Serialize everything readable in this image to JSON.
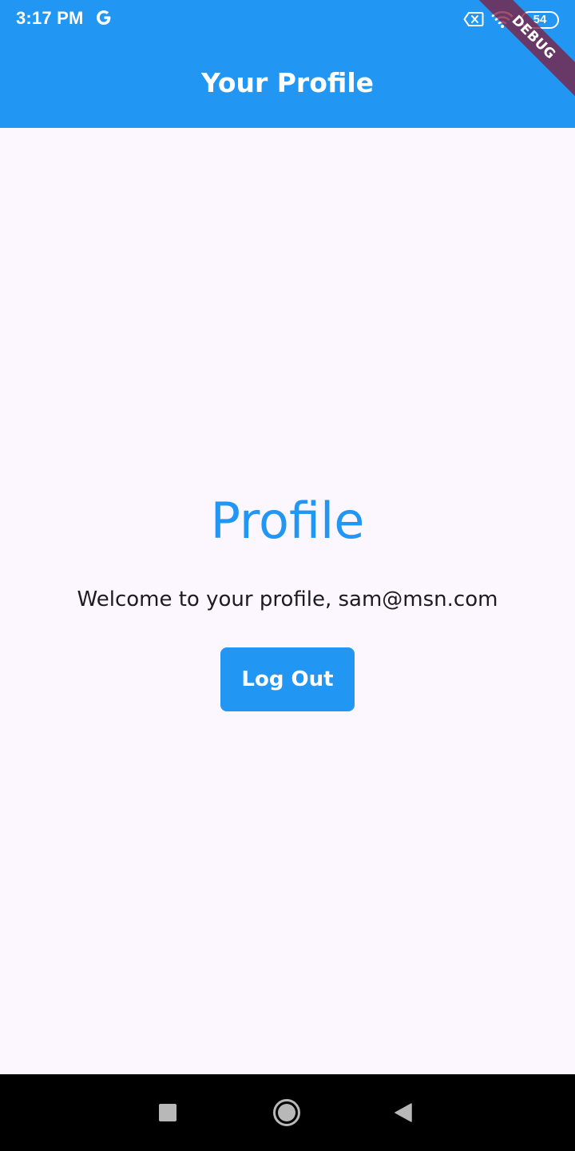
{
  "status_bar": {
    "time": "3:17 PM",
    "battery_level": "54",
    "icons": [
      "google-g-icon",
      "no-sim-icon",
      "wifi-icon",
      "battery-icon"
    ]
  },
  "app_bar": {
    "title": "Your Profile"
  },
  "debug_banner": {
    "label": "DEBUG"
  },
  "main": {
    "heading": "Profile",
    "welcome_message": "Welcome to your profile, sam@msn.com",
    "logout_label": "Log Out"
  },
  "nav_bar": {
    "buttons": [
      "recents-icon",
      "home-icon",
      "back-icon"
    ]
  },
  "colors": {
    "primary": "#2196f3",
    "background": "#fcf6ff",
    "text": "#1d1b20",
    "debug_banner": "#801838",
    "nav_bar": "#000000"
  }
}
